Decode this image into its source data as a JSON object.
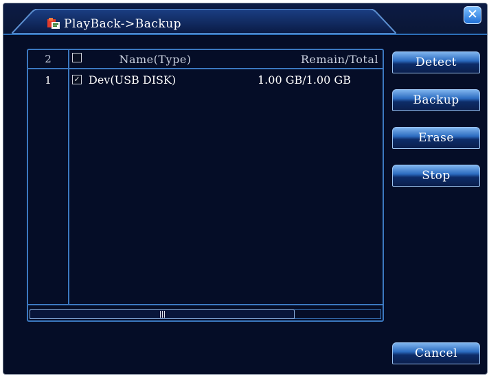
{
  "window": {
    "title": "PlayBack->Backup",
    "close_label": "✕"
  },
  "table": {
    "header": {
      "count": "2",
      "name": "Name(Type)",
      "remain_total": "Remain/Total"
    },
    "rows": [
      {
        "num": "1",
        "checked": true,
        "check_glyph": "✓",
        "name": "Dev(USB DISK)",
        "remain_total": "1.00 GB/1.00 GB"
      }
    ]
  },
  "buttons": {
    "detect": "Detect",
    "backup": "Backup",
    "erase": "Erase",
    "stop": "Stop",
    "cancel": "Cancel"
  },
  "colors": {
    "background": "#050d27",
    "accent": "#3b78c0",
    "button": "#2c6cc0"
  },
  "icons": {
    "title": "playback-folder-icon",
    "close": "close-icon"
  }
}
